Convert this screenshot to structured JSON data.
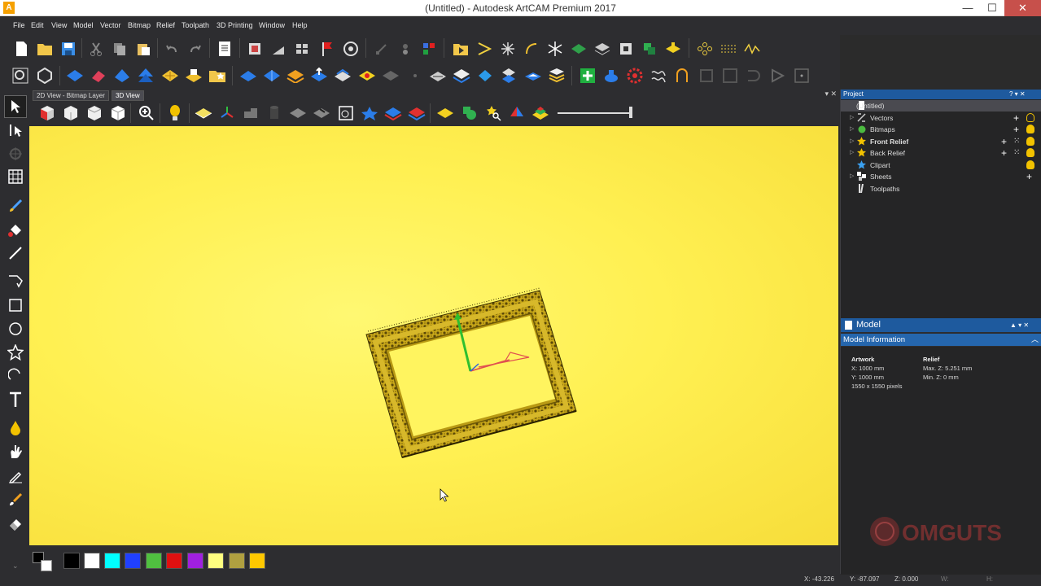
{
  "window": {
    "title": "(Untitled) - Autodesk ArtCAM Premium 2017",
    "logo_letter": "A",
    "min": "—",
    "max": "☐",
    "close": "✕"
  },
  "menu": [
    "File",
    "Edit",
    "View",
    "Model",
    "Vector",
    "Bitmap",
    "Relief",
    "Toolpath",
    "3D Printing",
    "Window",
    "Help"
  ],
  "view_tabs": [
    "2D View - Bitmap Layer",
    "3D View"
  ],
  "active_view_tab": "3D View",
  "view_tabs_pin": "▾ ✕",
  "project_panel": {
    "title": "Project",
    "buttons": "?  ▾  ✕",
    "items": [
      {
        "label": "(Untitled)",
        "bold": false,
        "icon": "document-icon"
      },
      {
        "label": "Vectors",
        "bold": false,
        "icon": "vectors-icon"
      },
      {
        "label": "Bitmaps",
        "bold": false,
        "icon": "bitmaps-icon"
      },
      {
        "label": "Front Relief",
        "bold": true,
        "icon": "star-icon"
      },
      {
        "label": "Back Relief",
        "bold": false,
        "icon": "star-icon"
      },
      {
        "label": "Clipart",
        "bold": false,
        "icon": "clipart-star-icon"
      },
      {
        "label": "Sheets",
        "bold": false,
        "icon": "sheets-icon"
      },
      {
        "label": "Toolpaths",
        "bold": false,
        "icon": "toolpaths-icon"
      }
    ]
  },
  "model_panel": {
    "title": "Model",
    "buttons": "▲ ▾ ✕",
    "info_title": "Model Information",
    "artwork": {
      "heading": "Artwork",
      "x": "X: 1000 mm",
      "y": "Y: 1000 mm",
      "pixels": "1550 x 1550 pixels"
    },
    "relief": {
      "heading": "Relief",
      "max_z": "Max. Z: 5.251 mm",
      "min_z": "Min. Z: 0 mm"
    }
  },
  "palette": {
    "colors": [
      "#000000",
      "#ffffff",
      "#00ffff",
      "#2040ff",
      "#50c040",
      "#e01010",
      "#a020e0",
      "#ffff80",
      "#b0a040",
      "#ffc800"
    ]
  },
  "status": {
    "x": "X: -43.226",
    "y": "Y: -87.097",
    "z": "Z: 0.000",
    "w": "W:",
    "h": "H:"
  },
  "watermark": "OMGUTS"
}
